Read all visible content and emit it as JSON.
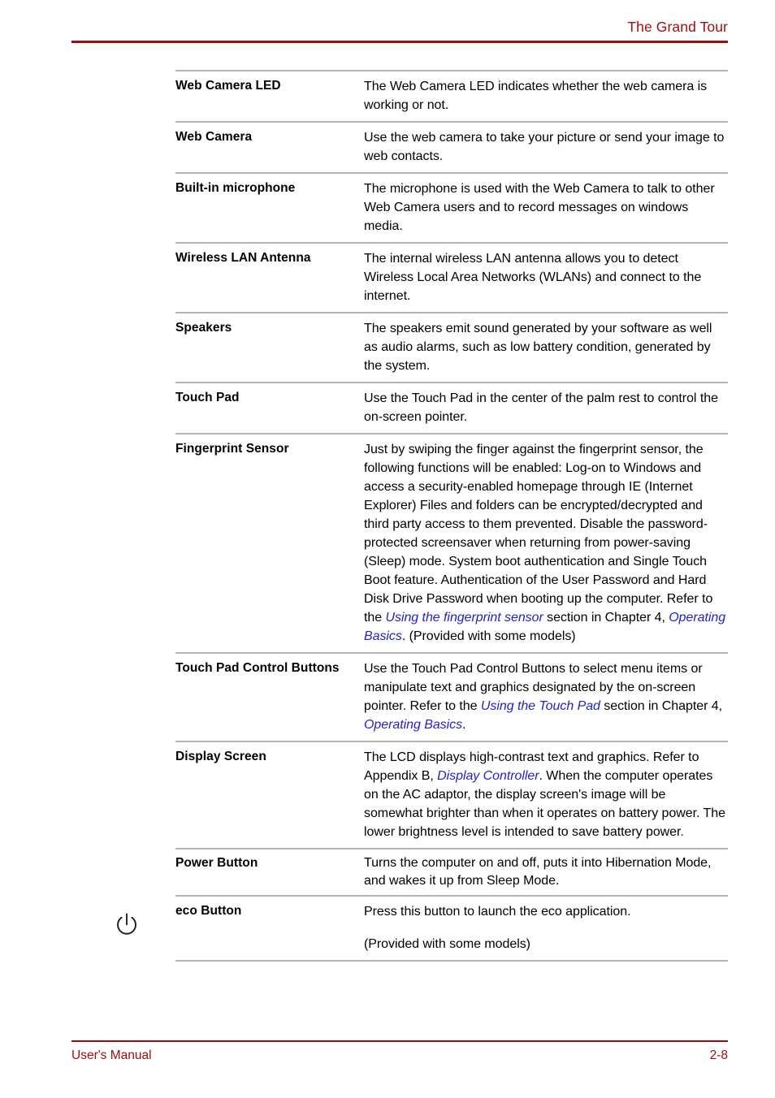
{
  "header": {
    "title": "The Grand Tour",
    "rule_color": "#9e0c0c"
  },
  "footer": {
    "manual_label": "User's Manual",
    "page_number": "2-8",
    "color": "#a30f0f"
  },
  "margin": {
    "power_icon_name": "power-symbol-icon"
  },
  "table": {
    "rule_color": "#b4b4b4",
    "link_color": "#2222cc",
    "rows": [
      {
        "term": "Web Camera LED",
        "desc": "The Web Camera LED indicates whether the web camera is working or not."
      },
      {
        "term": "Web Camera",
        "desc": "Use the web camera to take your picture or send your image to web contacts."
      },
      {
        "term": "Built-in microphone",
        "desc": "The microphone is used with the Web Camera to talk to other Web Camera users and to record messages on windows media."
      },
      {
        "term": "Wireless LAN Antenna",
        "desc": "The internal wireless LAN antenna allows you to detect Wireless Local Area Networks (WLANs) and connect to the internet."
      },
      {
        "term": "Speakers",
        "desc": "The speakers emit sound generated by your software as well as audio alarms, such as low battery condition, generated by the system."
      },
      {
        "term": "Touch Pad",
        "desc": "Use the Touch Pad in the center of the palm rest to control the on-screen pointer."
      },
      {
        "term": "Fingerprint Sensor",
        "desc_part1": "Just by swiping the finger against the fingerprint sensor, the following functions will be enabled: Log-on to Windows and access a security-enabled homepage through IE (Internet Explorer) Files and folders can be encrypted/decrypted and third party access to them prevented. Disable the password-protected screensaver when returning from power-saving (Sleep) mode. System boot authentication and Single Touch Boot feature. Authentication of the User Password and Hard Disk Drive Password when booting up the computer. Refer to the ",
        "link1": "Using the fingerprint sensor",
        "desc_part2": " section in Chapter 4, ",
        "link2": "Operating Basics",
        "desc_part3": ". (Provided with some models)"
      },
      {
        "term": "Touch Pad Control Buttons",
        "desc_part1": "Use the Touch Pad Control Buttons to select menu items or manipulate text and graphics designated by the on-screen pointer. Refer to the ",
        "link1": "Using the Touch Pad",
        "desc_part2": " section in Chapter 4, ",
        "link2": "Operating Basics",
        "desc_part3": "."
      },
      {
        "term": "Display Screen",
        "desc_part1": "The LCD displays high-contrast text and graphics. Refer to Appendix B, ",
        "link1": "Display Controller",
        "desc_part2": ". When the computer operates on the AC adaptor, the display screen's image will be somewhat brighter than when it operates on battery power. The lower brightness level is intended to save battery power."
      },
      {
        "term": "Power Button",
        "desc": "Turns the computer on and off, puts it into Hibernation Mode, and wakes it up from Sleep Mode."
      },
      {
        "term": "eco Button",
        "desc_p1": "Press this button to launch the eco application.",
        "desc_p2": "(Provided with some models)"
      }
    ]
  }
}
